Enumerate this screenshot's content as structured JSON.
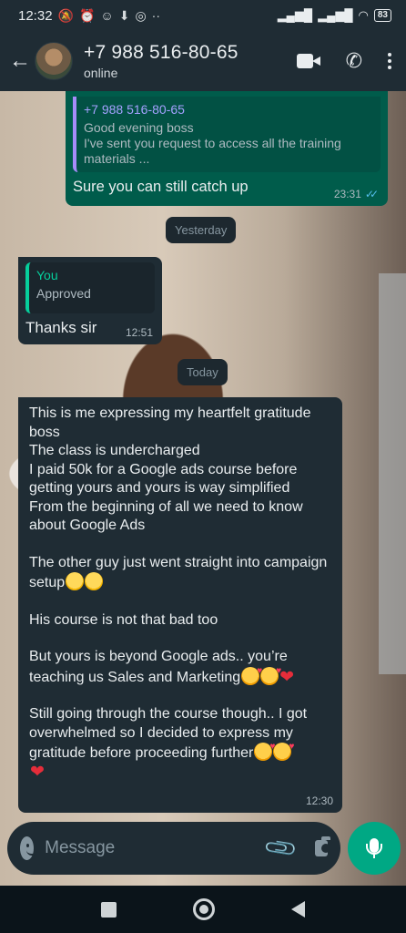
{
  "status_bar": {
    "time": "12:32",
    "battery": "83",
    "left_icons": [
      "mute-icon",
      "alarm-icon",
      "bot-icon",
      "download-icon",
      "instagram-icon",
      "more-icon"
    ],
    "right_icons": [
      "signal-icon",
      "signal-icon",
      "wifi-icon",
      "battery-icon"
    ]
  },
  "header": {
    "contact_name": "+7 988 516-80-65",
    "status": "online",
    "icons": [
      "back-arrow-icon",
      "video-call-icon",
      "voice-call-icon",
      "menu-icon"
    ]
  },
  "messages": [
    {
      "direction": "outgoing",
      "quote_author": "+7 988 516-80-65",
      "quote_text": "Good evening boss\nI've sent you request to access all the training materials ...",
      "text": "Sure you can still catch up",
      "time": "23:31",
      "read": true
    },
    {
      "direction": "incoming",
      "quote_author": "You",
      "quote_text": "Approved",
      "text": "Thanks sir",
      "time": "12:51"
    },
    {
      "direction": "incoming",
      "text_paragraphs": [
        "This is me expressing my heartfelt gratitude boss\nThe class is undercharged\nI paid 50k for a Google ads course before getting yours and yours is way simplified\nFrom the beginning of all we need to know about Google Ads",
        "The other guy just went straight into campaign setup",
        "His course is not that bad too",
        "But yours is beyond Google ads.. you’re teaching us Sales and Marketing",
        "Still going through the course though.. I got overwhelmed so I decided to express my gratitude before proceeding further"
      ],
      "emojis": {
        "p2": [
          "laughing-sweat",
          "laughing-sweat"
        ],
        "p4": [
          "smiling-hearts",
          "smiling-hearts",
          "red-heart"
        ],
        "p5": [
          "smiling-hearts",
          "smiling-hearts",
          "red-heart"
        ]
      },
      "time": "12:30"
    }
  ],
  "date_chips": [
    "Yesterday",
    "Today"
  ],
  "composer": {
    "placeholder": "Message"
  },
  "colors": {
    "outgoing_bubble": "#005c4b",
    "incoming_bubble": "#1f2c34",
    "accent": "#00a884",
    "read_ticks": "#53bdeb"
  }
}
